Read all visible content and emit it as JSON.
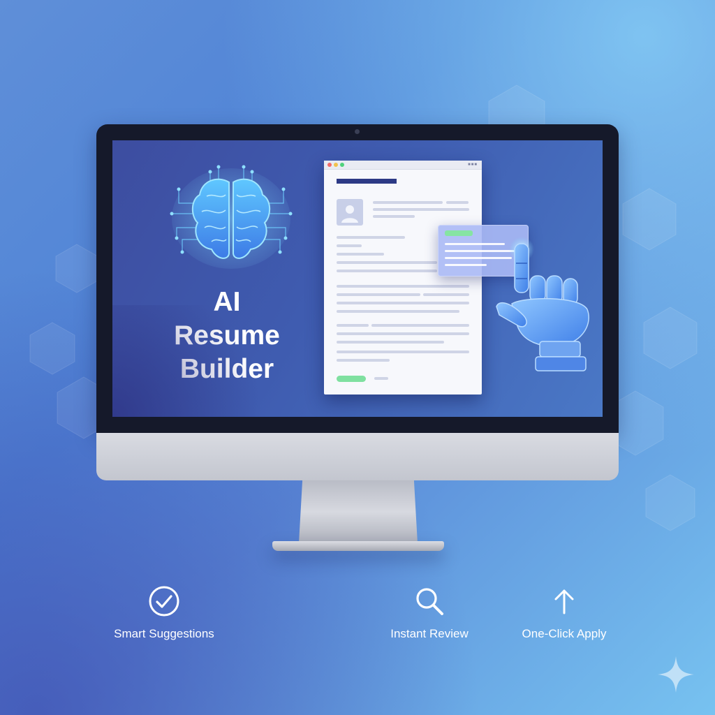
{
  "screen": {
    "title_lines": [
      "AI",
      "Resume",
      "Builder"
    ]
  },
  "features": [
    {
      "label": "Smart Suggestions",
      "icon": "check-circle-icon"
    },
    {
      "label": "Instant Review",
      "icon": "search-icon"
    },
    {
      "label": "One-Click Apply",
      "icon": "arrow-up-icon"
    }
  ],
  "colors": {
    "background_start": "#4f83d6",
    "background_end": "#77c2f0",
    "screen": "#3f5cb0",
    "accent_green": "#7fe0a0",
    "resume_heading": "#2d3a86"
  }
}
